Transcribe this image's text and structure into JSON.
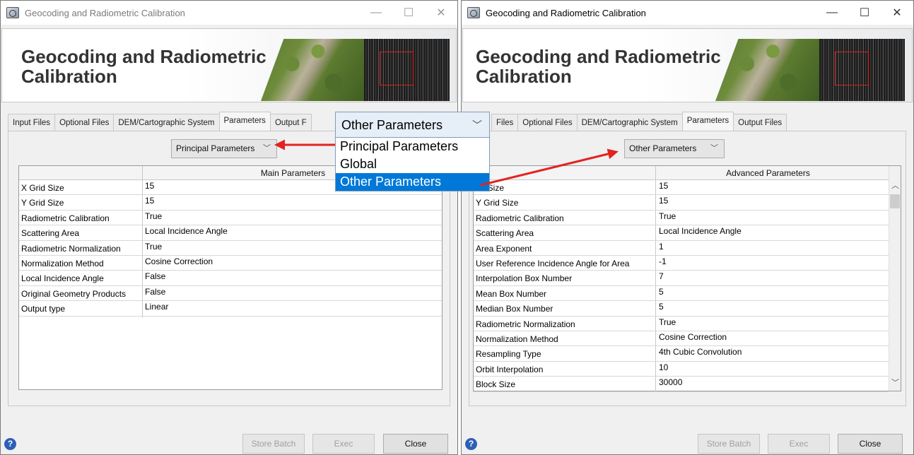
{
  "windows": [
    {
      "title": "Geocoding and Radiometric Calibration",
      "banner_title_line1": "Geocoding and Radiometric",
      "banner_title_line2": "Calibration",
      "tabs": [
        "Input Files",
        "Optional Files",
        "DEM/Cartographic System",
        "Parameters",
        "Output F"
      ],
      "active_tab": "Parameters",
      "combo_value": "Principal Parameters",
      "table_header": "Main Parameters",
      "rows": [
        {
          "name": "X Grid Size",
          "value": "15"
        },
        {
          "name": "Y Grid Size",
          "value": "15"
        },
        {
          "name": "Radiometric Calibration",
          "value": "True"
        },
        {
          "name": "Scattering Area",
          "value": "Local Incidence Angle"
        },
        {
          "name": "Radiometric Normalization",
          "value": "True"
        },
        {
          "name": "Normalization Method",
          "value": "Cosine Correction"
        },
        {
          "name": "Local Incidence Angle",
          "value": "False"
        },
        {
          "name": "Original Geometry Products",
          "value": "False"
        },
        {
          "name": "Output type",
          "value": "Linear"
        }
      ],
      "buttons": {
        "store_batch": "Store Batch",
        "exec": "Exec",
        "close": "Close"
      },
      "help": "?"
    },
    {
      "title": "Geocoding and Radiometric Calibration",
      "banner_title_line1": "Geocoding and Radiometric",
      "banner_title_line2": "Calibration",
      "tabs": [
        "Files",
        "Optional Files",
        "DEM/Cartographic System",
        "Parameters",
        "Output Files"
      ],
      "active_tab": "Parameters",
      "combo_value": "Other Parameters",
      "table_header": "Advanced Parameters",
      "rows": [
        {
          "name": "rid Size",
          "value": "15"
        },
        {
          "name": "Y Grid Size",
          "value": "15"
        },
        {
          "name": "Radiometric Calibration",
          "value": "True"
        },
        {
          "name": "Scattering Area",
          "value": "Local Incidence Angle"
        },
        {
          "name": "Area Exponent",
          "value": "1"
        },
        {
          "name": "User Reference Incidence Angle for  Area",
          "value": "-1"
        },
        {
          "name": "Interpolation Box Number",
          "value": "7"
        },
        {
          "name": "Mean Box Number",
          "value": "5"
        },
        {
          "name": "Median Box Number",
          "value": "5"
        },
        {
          "name": "Radiometric Normalization",
          "value": "True"
        },
        {
          "name": "Normalization Method",
          "value": "Cosine Correction"
        },
        {
          "name": "Resampling Type",
          "value": "4th Cubic Convolution"
        },
        {
          "name": "Orbit Interpolation",
          "value": "10"
        },
        {
          "name": "Block Size",
          "value": "30000"
        }
      ],
      "buttons": {
        "store_batch": "Store Batch",
        "exec": "Exec",
        "close": "Close"
      },
      "help": "?"
    }
  ],
  "dropdown": {
    "current": "Other Parameters",
    "options": [
      "Principal Parameters",
      "Global",
      "Other Parameters"
    ],
    "selected": "Other Parameters"
  },
  "window_controls": {
    "minimize": "—",
    "maximize": "☐",
    "close": "✕"
  },
  "colors": {
    "arrow": "#e32222",
    "selection": "#0078d7",
    "help": "#2d5fb6"
  }
}
